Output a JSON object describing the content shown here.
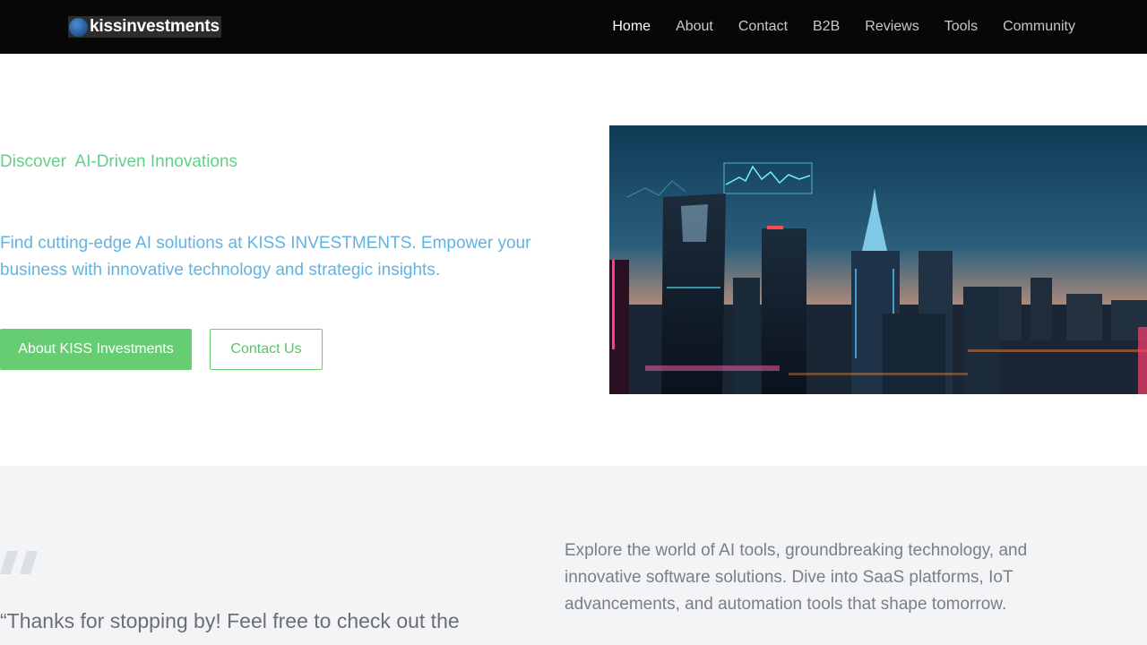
{
  "header": {
    "logo_text": "kissinvestments",
    "nav": [
      {
        "label": "Home",
        "active": true
      },
      {
        "label": "About"
      },
      {
        "label": "Contact"
      },
      {
        "label": "B2B"
      },
      {
        "label": "Reviews"
      },
      {
        "label": "Tools"
      },
      {
        "label": "Community"
      }
    ]
  },
  "hero": {
    "kicker": "Discover  AI-Driven Innovations",
    "lead": "Find cutting-edge AI solutions at KISS INVESTMENTS. Empower your business with innovative technology and strategic insights.",
    "primary_button": "About KISS Investments",
    "secondary_button": "Contact Us",
    "image_icon": "city-skyline-image"
  },
  "lower": {
    "quote_icon": "quote-mark-icon",
    "quote_text": "“Thanks for stopping by! Feel free to check out the",
    "description": "Explore the world of AI tools, groundbreaking technology, and innovative software solutions. Dive into SaaS platforms, IoT advancements, and automation tools that shape tomorrow."
  },
  "colors": {
    "header_bg": "#070707",
    "accent_green": "#66cd73",
    "kicker_green": "#62d089",
    "lead_blue": "#63b3e0",
    "section_bg": "#f3f4f6"
  }
}
